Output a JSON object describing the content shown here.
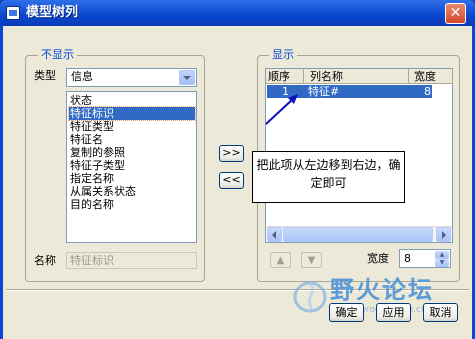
{
  "window": {
    "title": "模型树列"
  },
  "hidden_group": {
    "title": "不显示",
    "type_label": "类型",
    "type_value": "信息",
    "items": [
      "状态",
      "特征标识",
      "特征类型",
      "特征名",
      "复制的参照",
      "特征子类型",
      "指定名称",
      "从属关系状态",
      "目的名称"
    ],
    "name_label": "名称",
    "name_value": "特征标识"
  },
  "transfer": {
    "add_label": ">>",
    "remove_label": "<<"
  },
  "shown_group": {
    "title": "显示",
    "columns": [
      "顺序",
      "列名称",
      "宽度"
    ],
    "rows": [
      {
        "order": "1",
        "name": "特征#",
        "width": "8"
      }
    ],
    "width_label": "宽度",
    "width_value": "8"
  },
  "callout": {
    "text": "把此项从左边移到右边，确定即可"
  },
  "footer": {
    "ok_label": "确定",
    "apply_label": "应用",
    "cancel_label": "取消"
  },
  "watermark": {
    "title": "野火论坛",
    "url": "www.proewildfire.cn"
  },
  "colors": {
    "titlebar": "#0a46d0",
    "selection": "#316ac5",
    "group_title": "#0046d5"
  }
}
